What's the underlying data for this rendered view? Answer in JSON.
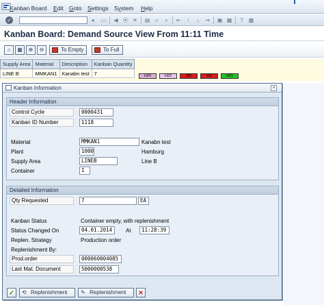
{
  "menu": {
    "items": [
      {
        "label": "Kanban Board",
        "underline": "K"
      },
      {
        "label": "Edit",
        "underline": "E"
      },
      {
        "label": "Goto",
        "underline": "G"
      },
      {
        "label": "Settings",
        "underline": "S"
      },
      {
        "label": "System",
        "underline": "y"
      },
      {
        "label": "Help",
        "underline": "H"
      }
    ]
  },
  "title": "Kanban Board: Demand Source View From 11:11 Time",
  "app_toolbar": {
    "to_empty": "To Empty",
    "to_full": "To Full"
  },
  "table": {
    "headers": [
      "Supply Area",
      "Material",
      "Description",
      "Kanban Quantity"
    ],
    "row": [
      "LINE B",
      "MMKAN1",
      "Kanabn test",
      "7"
    ]
  },
  "containers": [
    {
      "label": "H20",
      "color": "#d9b0d9"
    },
    {
      "label": "H22",
      "color": "#e6c8ea"
    },
    {
      "label": "I00",
      "color": "#d81b1b"
    },
    {
      "label": "I00",
      "color": "#d81b1b"
    },
    {
      "label": "H21",
      "color": "#22c41f"
    }
  ],
  "dialog": {
    "title": "Kanban Information",
    "header_group": {
      "title": "Header Information",
      "control_cycle_label": "Control Cycle",
      "control_cycle": "0000431",
      "kanban_id_label": "Kanban ID Number",
      "kanban_id": "1118",
      "material_label": "Material",
      "material": "MMKAN1",
      "material_desc": "Kanabn test",
      "plant_label": "Plant",
      "plant": "1000",
      "plant_desc": "Hamburg",
      "supply_area_label": "Supply Area",
      "supply_area": "LINEB",
      "supply_area_desc": "Line B",
      "container_label": "Container",
      "container": "1"
    },
    "detail_group": {
      "title": "Detailed Information",
      "qty_label": "Qty Requested",
      "qty": "7",
      "unit": "EA",
      "status_label": "Kanban Status",
      "status": "Container empty, with replenishment",
      "changed_label": "Status Changed On",
      "changed_date": "04.01.2014",
      "at_label": "At",
      "changed_time": "11:28:39",
      "strategy_label": "Replen. Strategy",
      "strategy": "Production order",
      "repl_by_label": "Replenishment By:",
      "prod_order_label": "Prod.order",
      "prod_order": "000060004085",
      "last_doc_label": "Last Mat. Document",
      "last_doc": "5000000538"
    },
    "footer": {
      "replenishment_1": "Replenishment",
      "replenishment_2": "Replenishment"
    }
  },
  "colors": {
    "title": "#1a2b44",
    "dialog_bg": "#dde7f1",
    "group_header": "#c8d6e5"
  }
}
